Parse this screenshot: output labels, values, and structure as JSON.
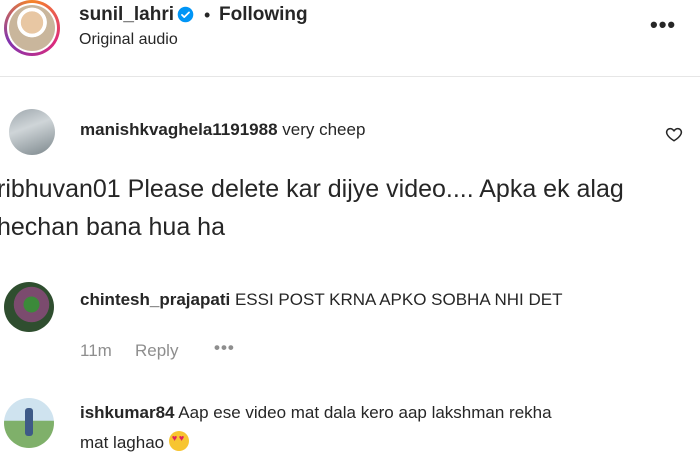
{
  "header": {
    "author": "sunil_lahri",
    "separator": "•",
    "follow_status": "Following",
    "audio": "Original audio",
    "more": "•••"
  },
  "comments": [
    {
      "username": "manishkvaghela1191988",
      "text": "very cheep"
    },
    {
      "line1": "ribhuvan01 Please delete kar dijye video.... Apka ek alag",
      "line2": "hechan bana hua ha"
    },
    {
      "username": "chintesh_prajapati",
      "text": "ESSI POST KRNA APKO SOBHA NHI DET",
      "time": "11m",
      "reply": "Reply",
      "more": "•••"
    },
    {
      "username": "ishkumar84",
      "text": "Aap ese video mat dala kero aap lakshman rekha",
      "text2": "mat laghao"
    }
  ],
  "colors": {
    "accent": "#0095f6",
    "muted": "#8e8e8e",
    "text": "#262626"
  },
  "icons": [
    "verified-badge-icon",
    "more-options-icon",
    "heart-outline-icon",
    "heart-eyes-emoji"
  ]
}
